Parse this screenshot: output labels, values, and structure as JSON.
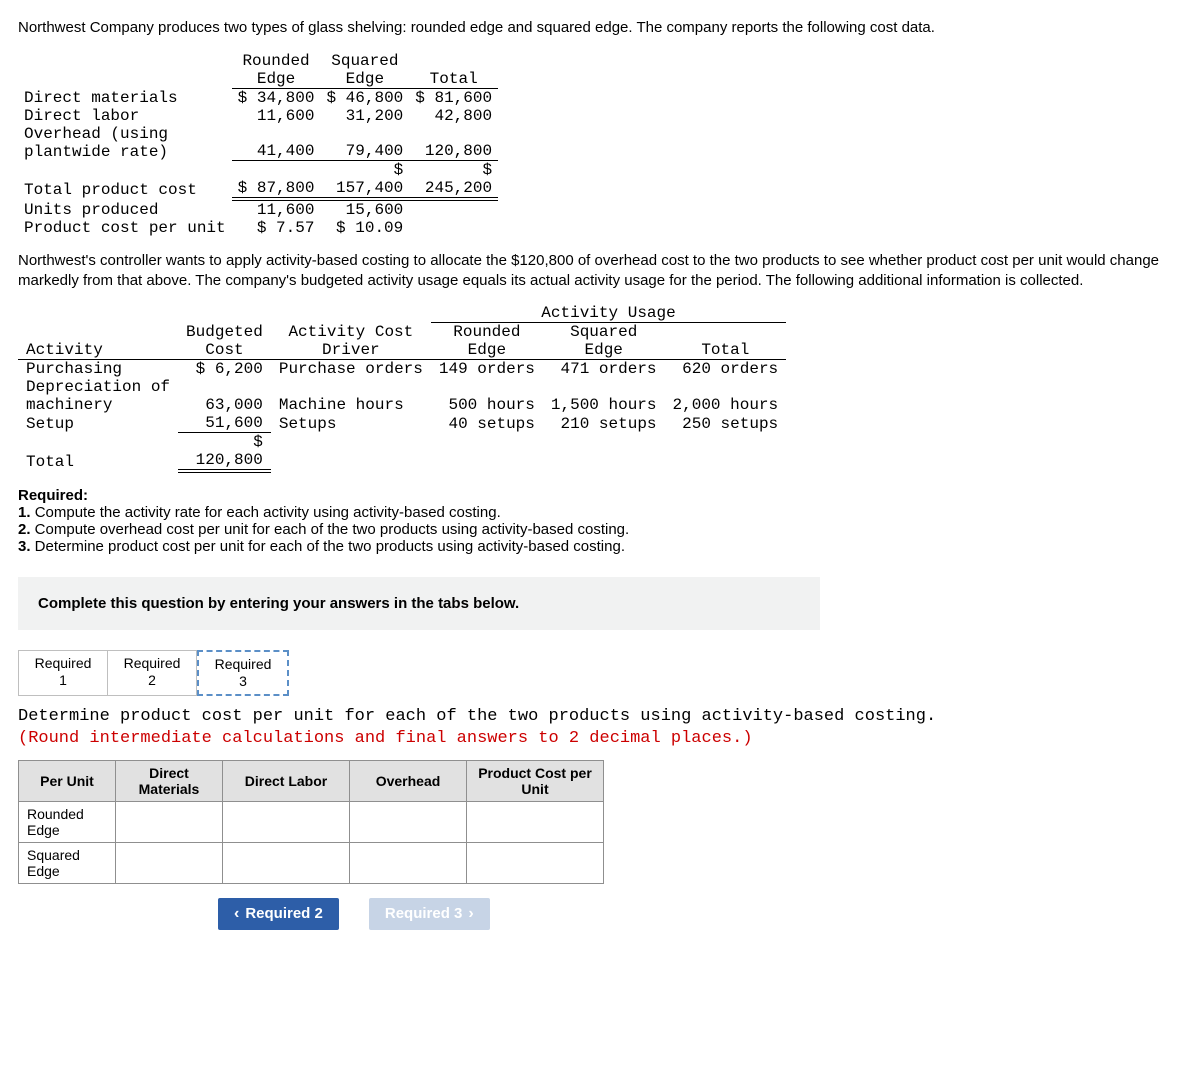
{
  "intro": "Northwest Company produces two types of glass shelving: rounded edge and squared edge. The company reports the following cost data.",
  "t1": {
    "h_rounded_l1": "Rounded",
    "h_rounded_l2": "Edge",
    "h_squared_l1": "Squared",
    "h_squared_l2": "Edge",
    "h_total": "Total",
    "rows": {
      "dm_label": "Direct materials",
      "dm_r": "$ 34,800",
      "dm_s": "$ 46,800",
      "dm_t": "$ 81,600",
      "dl_label": "Direct labor",
      "dl_r": "11,600",
      "dl_s": "31,200",
      "dl_t": "42,800",
      "oh_label1": "Overhead (using",
      "oh_label2": "plantwide rate)",
      "oh_r": "41,400",
      "oh_s": "79,400",
      "oh_t": "120,800",
      "tpc_label": "Total product cost",
      "tpc_r": "$ 87,800",
      "tpc_s1": "$",
      "tpc_s2": "157,400",
      "tpc_t1": "$",
      "tpc_t2": "245,200",
      "up_label": "Units produced",
      "up_r": "11,600",
      "up_s": "15,600",
      "pcu_label": "Product cost per unit",
      "pcu_r": "$ 7.57",
      "pcu_s": "$ 10.09"
    }
  },
  "para2": "Northwest's controller wants to apply activity-based costing to allocate the $120,800 of overhead cost to the two products to see whether product cost per unit would change markedly from that above. The company's budgeted activity usage equals its actual activity usage for the period. The following additional information is collected.",
  "t2": {
    "h_activity": "Activity",
    "h_budgeted_l1": "Budgeted",
    "h_budgeted_l2": "Cost",
    "h_driver_l1": "Activity Cost",
    "h_driver_l2": "Driver",
    "h_usage": "Activity Usage",
    "h_rounded_l1": "Rounded",
    "h_rounded_l2": "Edge",
    "h_squared_l1": "Squared",
    "h_squared_l2": "Edge",
    "h_total": "Total",
    "r1_act": "Purchasing",
    "r1_cost": "$ 6,200",
    "r1_drv": "Purchase orders",
    "r1_re": "149 orders",
    "r1_se": "471 orders",
    "r1_tot": "620 orders",
    "r2_act1": "Depreciation of",
    "r2_act2": "machinery",
    "r2_cost": "63,000",
    "r2_drv": "Machine hours",
    "r2_re": "500 hours",
    "r2_se": "1,500 hours",
    "r2_tot": "2,000 hours",
    "r3_act": "Setup",
    "r3_cost": "51,600",
    "r3_drv": "Setups",
    "r3_re": "40 setups",
    "r3_se": "210 setups",
    "r3_tot": "250 setups",
    "tot_label": "Total",
    "tot_cost1": "$",
    "tot_cost2": "120,800"
  },
  "req_heading": "Required:",
  "req1": "1. Compute the activity rate for each activity using activity-based costing.",
  "req2": "2. Compute overhead cost per unit for each of the two products using activity-based costing.",
  "req3": "3. Determine product cost per unit for each of the two products using activity-based costing.",
  "complete_bar": "Complete this question by entering your answers in the tabs below.",
  "tabs": {
    "t1l1": "Required",
    "t1l2": "1",
    "t2l1": "Required",
    "t2l2": "2",
    "t3l1": "Required",
    "t3l2": "3"
  },
  "instruct_main": "Determine product cost per unit for each of the two products using activity-based costing.",
  "instruct_note": "(Round intermediate calculations and final answers to 2 decimal places.)",
  "ans": {
    "h_per_unit": "Per Unit",
    "h_dm": "Direct Materials",
    "h_dl": "Direct Labor",
    "h_oh": "Overhead",
    "h_pcpu": "Product Cost per Unit",
    "row1": "Rounded Edge",
    "row2": "Squared Edge"
  },
  "nav": {
    "prev": "Required 2",
    "next": "Required 3"
  }
}
